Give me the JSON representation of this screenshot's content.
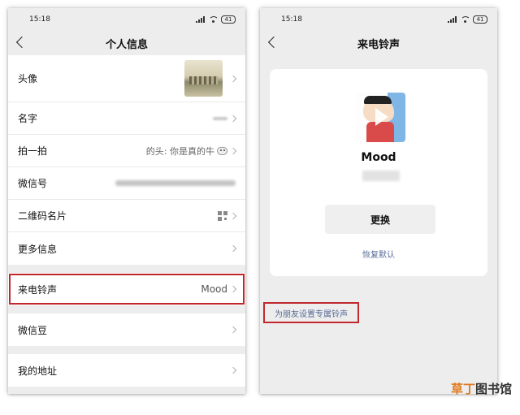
{
  "left": {
    "status": {
      "time": "15:18",
      "battery": "41"
    },
    "title": "个人信息",
    "rows": {
      "avatar": "头像",
      "name": "名字",
      "pat": "拍一拍",
      "pat_value": "的头: 你是真的牛",
      "wechat_id": "微信号",
      "qr": "二维码名片",
      "more": "更多信息",
      "ringtone": "来电铃声",
      "ringtone_value": "Mood",
      "beans": "微信豆",
      "address": "我的地址"
    }
  },
  "right": {
    "status": {
      "time": "15:18",
      "battery": "41"
    },
    "title": "来电铃声",
    "song_title": "Mood",
    "change_button": "更换",
    "restore_default": "恢复默认",
    "friend_ringtone": "为朋友设置专属铃声"
  },
  "watermark": {
    "part1": "草丁",
    "part2": "图书馆"
  },
  "colors": {
    "highlight": "#c0282d",
    "link": "#576b95",
    "background": "#ededed"
  }
}
